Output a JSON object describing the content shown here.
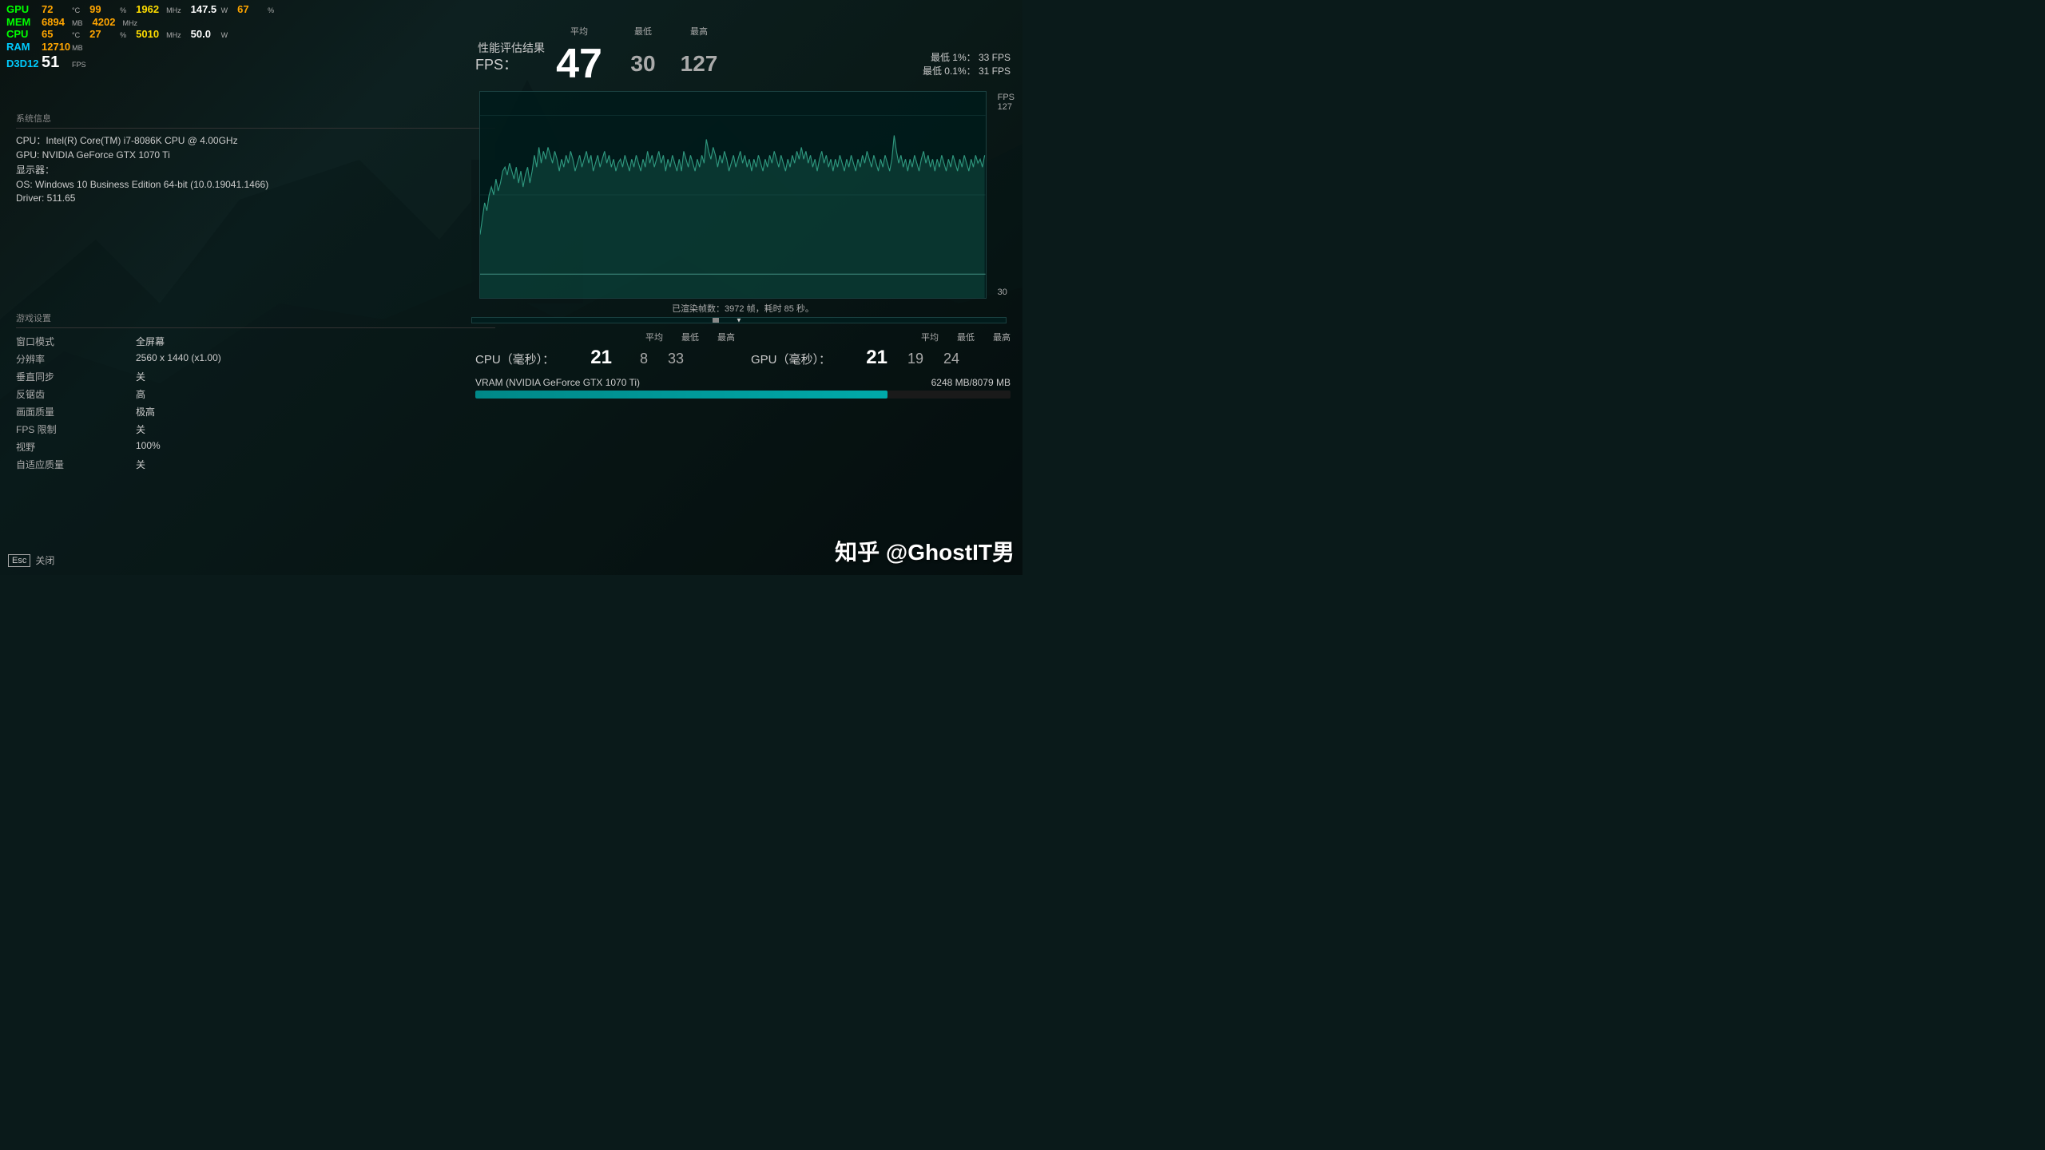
{
  "hud": {
    "gpu_label": "GPU",
    "gpu_temp": "72",
    "gpu_temp_unit": "°C",
    "gpu_load": "99",
    "gpu_load_unit": "%",
    "gpu_clock": "1962",
    "gpu_clock_unit": "MHz",
    "gpu_power": "147.5",
    "gpu_power_unit": "W",
    "gpu_vram": "67",
    "gpu_vram_unit": "%",
    "mem_label": "MEM",
    "mem_val": "6894",
    "mem_unit": "MB",
    "mem_freq": "4202",
    "mem_freq_unit": "MHz",
    "cpu_label": "CPU",
    "cpu_temp": "65",
    "cpu_temp_unit": "°C",
    "cpu_load": "27",
    "cpu_load_unit": "%",
    "cpu_clock": "5010",
    "cpu_clock_unit": "MHz",
    "cpu_power": "50.0",
    "cpu_power_unit": "W",
    "ram_label": "RAM",
    "ram_val": "12710",
    "ram_unit": "MB",
    "d3d_label": "D3D12",
    "d3d_fps": "51",
    "d3d_fps_unit": "FPS"
  },
  "system_info": {
    "title": "系统信息",
    "cpu": "CPU：Intel(R) Core(TM) i7-8086K CPU @ 4.00GHz",
    "gpu": "GPU: NVIDIA GeForce GTX 1070 Ti",
    "display": "显示器：",
    "os": "OS: Windows 10 Business Edition 64-bit (10.0.19041.1466)",
    "driver": "Driver: 511.65"
  },
  "game_settings": {
    "title": "游戏设置",
    "window_mode_key": "窗口模式",
    "window_mode_val": "全屏幕",
    "resolution_key": "分辨率",
    "resolution_val": "2560 x 1440 (x1.00)",
    "vsync_key": "垂直同步",
    "vsync_val": "关",
    "aa_key": "反锯齿",
    "aa_val": "高",
    "quality_key": "画面质量",
    "quality_val": "极高",
    "fps_limit_key": "FPS 限制",
    "fps_limit_val": "关",
    "fov_key": "视野",
    "fov_val": "100%",
    "adaptive_key": "自适应质量",
    "adaptive_val": "关"
  },
  "perf": {
    "title": "性能评估结果",
    "fps_label": "FPS：",
    "avg_header": "平均",
    "min_header": "最低",
    "max_header": "最高",
    "fps_avg": "47",
    "fps_min": "30",
    "fps_max": "127",
    "percentile_1_label": "最低 1%：",
    "percentile_1_val": "33 FPS",
    "percentile_01_label": "最低 0.1%：",
    "percentile_01_val": "31 FPS",
    "chart_fps_label": "FPS",
    "chart_y_max": "127",
    "chart_y_min": "30",
    "frames_info": "已渲染帧数：3972 帧，耗时 85 秒。",
    "cpu_ms_label": "CPU（毫秒）：",
    "cpu_avg_header": "平均",
    "cpu_min_header": "最低",
    "cpu_max_header": "最高",
    "cpu_avg": "21",
    "cpu_min": "8",
    "cpu_max": "33",
    "gpu_ms_label": "GPU（毫秒）：",
    "gpu_avg": "21",
    "gpu_min": "19",
    "gpu_max": "24",
    "vram_label": "VRAM (NVIDIA GeForce GTX 1070 Ti)",
    "vram_val": "6248 MB/8079 MB",
    "vram_percent": 77
  },
  "footer": {
    "esc_label": "Esc",
    "close_label": "关闭",
    "watermark": "知乎 @GhostIT男"
  }
}
